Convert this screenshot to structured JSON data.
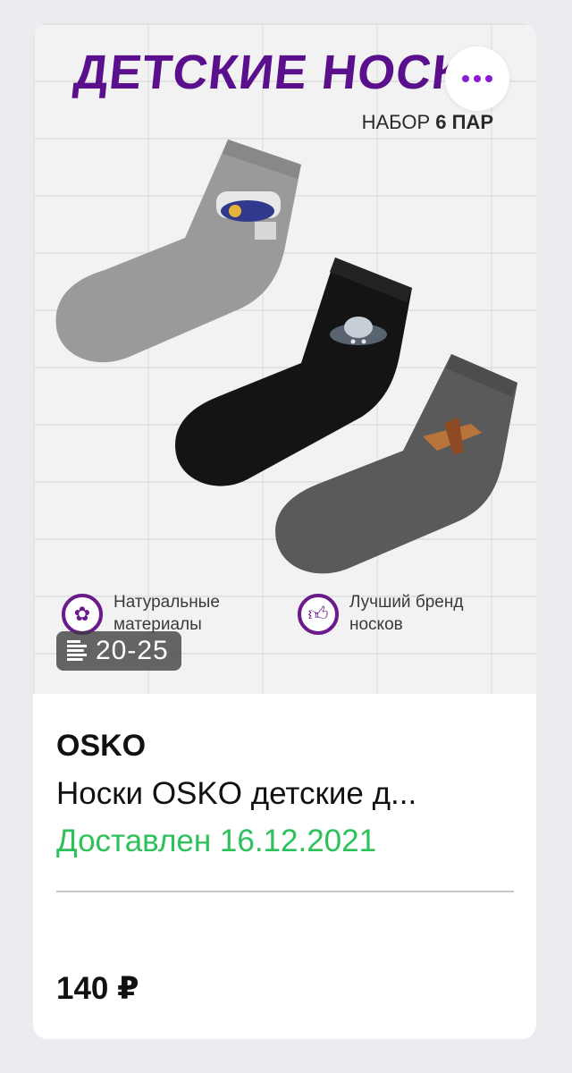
{
  "product_image": {
    "banner_title": "ДЕТСКИЕ НОСК",
    "banner_subtitle_prefix": "НАБОР",
    "banner_subtitle_bold": "6 ПАР",
    "features": [
      {
        "label": "Натуральные материалы",
        "icon": "cotton-icon"
      },
      {
        "label": "Лучший бренд носков",
        "icon": "thumbs-up-icon"
      }
    ],
    "size_badge": "20-25",
    "more_button_icon": "more-dots-icon"
  },
  "product": {
    "brand": "OSKO",
    "name": "Носки OSKO детские д...",
    "status": "Доставлен 16.12.2021",
    "price": "140 ₽"
  },
  "colors": {
    "accent": "#8a1cd6",
    "status_green": "#2ec05a",
    "banner_purple": "#5a0f8c"
  }
}
